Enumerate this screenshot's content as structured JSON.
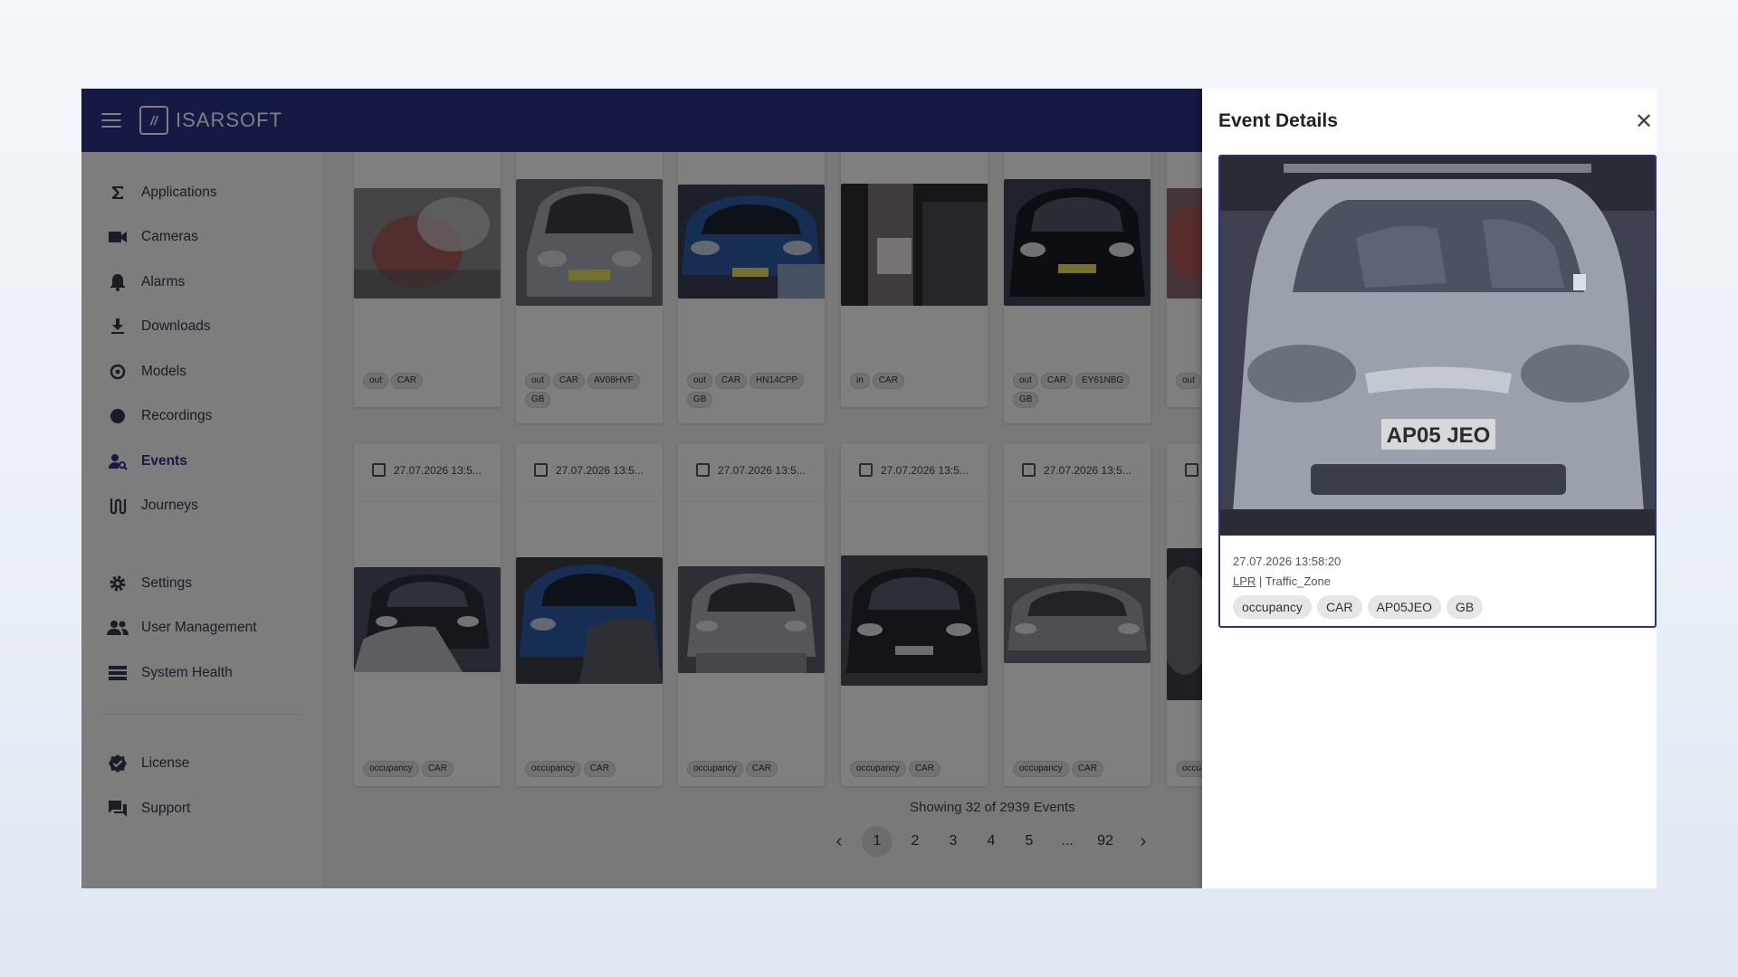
{
  "brand": {
    "name": "ISARSOFT"
  },
  "sidebar": {
    "items": [
      {
        "label": "Applications",
        "icon": "sigma-icon"
      },
      {
        "label": "Cameras",
        "icon": "camera-icon"
      },
      {
        "label": "Alarms",
        "icon": "bell-icon"
      },
      {
        "label": "Downloads",
        "icon": "download-icon"
      },
      {
        "label": "Models",
        "icon": "models-icon"
      },
      {
        "label": "Recordings",
        "icon": "record-icon"
      },
      {
        "label": "Events",
        "icon": "person-search-icon",
        "active": true
      },
      {
        "label": "Journeys",
        "icon": "journey-icon"
      }
    ],
    "settings_items": [
      {
        "label": "Settings",
        "icon": "gear-icon"
      },
      {
        "label": "User Management",
        "icon": "users-icon"
      },
      {
        "label": "System Health",
        "icon": "list-icon"
      }
    ],
    "footer_items": [
      {
        "label": "License",
        "icon": "verified-icon"
      },
      {
        "label": "Support",
        "icon": "chat-icon"
      }
    ]
  },
  "events": {
    "row1": [
      {
        "chips": [
          "out",
          "CAR"
        ]
      },
      {
        "chips": [
          "out",
          "CAR",
          "AV08HVF",
          "GB"
        ]
      },
      {
        "chips": [
          "out",
          "CAR",
          "HN14CPP",
          "GB"
        ]
      },
      {
        "chips": [
          "in",
          "CAR"
        ]
      },
      {
        "chips": [
          "out",
          "CAR",
          "EY61NBG",
          "GB"
        ]
      },
      {
        "chips": [
          "out"
        ]
      }
    ],
    "row2": [
      {
        "date": "27.07.2026 13:5...",
        "chips": [
          "occupancy",
          "CAR"
        ]
      },
      {
        "date": "27.07.2026 13:5...",
        "chips": [
          "occupancy",
          "CAR"
        ]
      },
      {
        "date": "27.07.2026 13:5...",
        "chips": [
          "occupancy",
          "CAR"
        ]
      },
      {
        "date": "27.07.2026 13:5...",
        "chips": [
          "occupancy",
          "CAR"
        ]
      },
      {
        "date": "27.07.2026 13:5...",
        "chips": [
          "occupancy",
          "CAR"
        ]
      },
      {
        "date": "",
        "chips": [
          "occu"
        ]
      }
    ]
  },
  "pagination": {
    "info": "Showing 32 of 2939 Events",
    "pages": [
      "1",
      "2",
      "3",
      "4",
      "5",
      "...",
      "92"
    ],
    "active_page": "1",
    "prev_icon": "chevron-left-icon",
    "next_icon": "chevron-right-icon"
  },
  "details": {
    "title": "Event Details",
    "close_icon": "close-icon",
    "date": "27.07.2026 13:58:20",
    "type": "LPR",
    "separator": "|",
    "zone": "Traffic_Zone",
    "plate_text": "AP05 JEO",
    "chips": [
      "occupancy",
      "CAR",
      "AP05JEO",
      "GB"
    ]
  },
  "colors": {
    "primary": "#2a3286",
    "overlay": "rgba(0,0,0,0.5)"
  }
}
